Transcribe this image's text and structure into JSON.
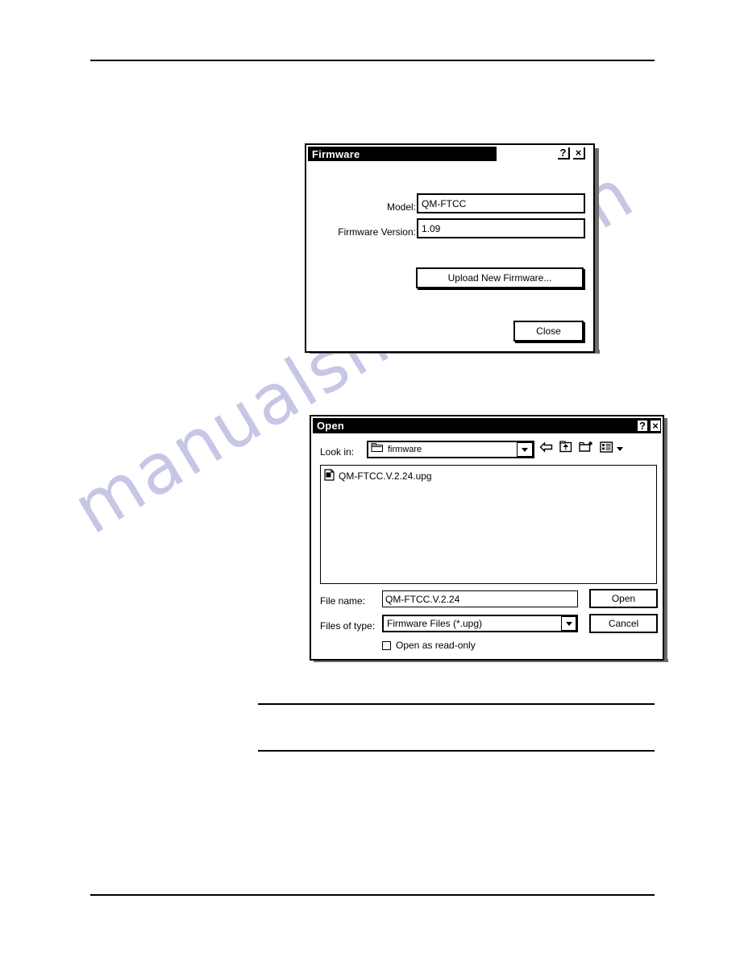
{
  "page": {
    "watermark_text": "manualshive.com",
    "watermark_color": "#c3c3e4",
    "rules": {
      "header": "header-rule",
      "footer": "footer-rule",
      "note_top": "note-rule-top",
      "note_bottom": "note-rule-bottom"
    }
  },
  "firmware_dialog": {
    "title": "Firmware",
    "help_label": "?",
    "close_label": "×",
    "fields": [
      {
        "label": "Model:",
        "value": "QM-FTCC"
      },
      {
        "label": "Firmware Version:",
        "value": "1.09"
      }
    ],
    "upload_button": "Upload New Firmware...",
    "close_button": "Close"
  },
  "open_dialog": {
    "title": "Open",
    "help_label": "?",
    "close_label": "×",
    "look_in_label": "Look in:",
    "look_in_value": "firmware",
    "toolbar": [
      {
        "name": "back-icon",
        "tooltip": "Back"
      },
      {
        "name": "up-one-level-icon",
        "tooltip": "Up One Level"
      },
      {
        "name": "new-folder-icon",
        "tooltip": "Create New Folder"
      },
      {
        "name": "views-icon",
        "tooltip": "Views"
      }
    ],
    "files": [
      {
        "name": "QM-FTCC.V.2.24.upg",
        "icon": "file-icon"
      }
    ],
    "file_name_label": "File name:",
    "file_name_value": "QM-FTCC.V.2.24",
    "files_of_type_label": "Files of type:",
    "files_of_type_value": "Firmware Files (*.upg)",
    "open_button": "Open",
    "cancel_button": "Cancel",
    "read_only_label": "Open as read-only",
    "read_only_checked": false
  }
}
